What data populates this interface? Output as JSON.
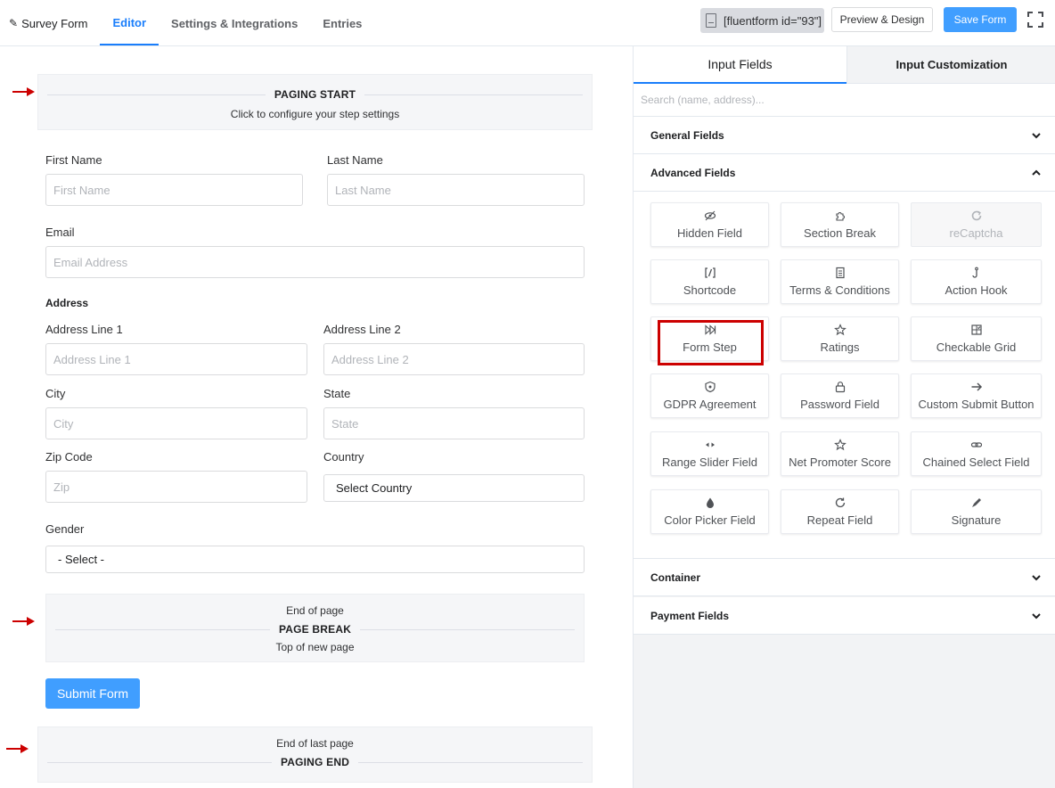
{
  "topbar": {
    "brand": "Survey Form",
    "tabs": [
      "Editor",
      "Settings & Integrations",
      "Entries"
    ],
    "shortcode": "[fluentform id=\"93\"]",
    "preview_label": "Preview & Design",
    "save_label": "Save Form"
  },
  "editor": {
    "paging_start": {
      "title": "PAGING START",
      "subtitle": "Click to configure your step settings"
    },
    "first_name": {
      "label": "First Name",
      "placeholder": "First Name"
    },
    "last_name": {
      "label": "Last Name",
      "placeholder": "Last Name"
    },
    "email": {
      "label": "Email",
      "placeholder": "Email Address"
    },
    "address": {
      "heading": "Address",
      "line1": {
        "label": "Address Line 1",
        "placeholder": "Address Line 1"
      },
      "line2": {
        "label": "Address Line 2",
        "placeholder": "Address Line 2"
      },
      "city": {
        "label": "City",
        "placeholder": "City"
      },
      "state": {
        "label": "State",
        "placeholder": "State"
      },
      "zip": {
        "label": "Zip Code",
        "placeholder": "Zip"
      },
      "country": {
        "label": "Country",
        "value": "Select Country"
      }
    },
    "gender": {
      "label": "Gender",
      "value": "- Select -"
    },
    "page_break": {
      "top": "End of page",
      "title": "PAGE BREAK",
      "bottom": "Top of new page"
    },
    "submit_label": "Submit Form",
    "paging_end": {
      "top": "End of last page",
      "title": "PAGING END"
    }
  },
  "sidebar": {
    "tabs": [
      "Input Fields",
      "Input Customization"
    ],
    "search_placeholder": "Search (name, address)...",
    "sections": {
      "general": "General Fields",
      "advanced": "Advanced Fields",
      "container": "Container",
      "payment": "Payment Fields"
    },
    "advanced_fields": [
      {
        "label": "Hidden Field",
        "icon": "eye-slash-icon"
      },
      {
        "label": "Section Break",
        "icon": "puzzle-icon"
      },
      {
        "label": "reCaptcha",
        "icon": "recaptcha-icon",
        "disabled": true
      },
      {
        "label": "Shortcode",
        "icon": "shortcode-icon"
      },
      {
        "label": "Terms & Conditions",
        "icon": "document-icon"
      },
      {
        "label": "Action Hook",
        "icon": "hook-icon"
      },
      {
        "label": "Form Step",
        "icon": "fast-forward-icon",
        "highlighted": true
      },
      {
        "label": "Ratings",
        "icon": "star-icon"
      },
      {
        "label": "Checkable Grid",
        "icon": "grid-check-icon"
      },
      {
        "label": "GDPR Agreement",
        "icon": "shield-icon"
      },
      {
        "label": "Password Field",
        "icon": "lock-icon"
      },
      {
        "label": "Custom Submit Button",
        "icon": "arrow-right-icon"
      },
      {
        "label": "Range Slider Field",
        "icon": "range-icon"
      },
      {
        "label": "Net Promoter Score",
        "icon": "star-icon"
      },
      {
        "label": "Chained Select Field",
        "icon": "link-icon"
      },
      {
        "label": "Color Picker Field",
        "icon": "drop-icon"
      },
      {
        "label": "Repeat Field",
        "icon": "repeat-icon"
      },
      {
        "label": "Signature",
        "icon": "pen-icon"
      }
    ]
  },
  "colors": {
    "accent": "#1a7efb",
    "primary_button": "#409eff",
    "annotation": "#cc0000"
  }
}
